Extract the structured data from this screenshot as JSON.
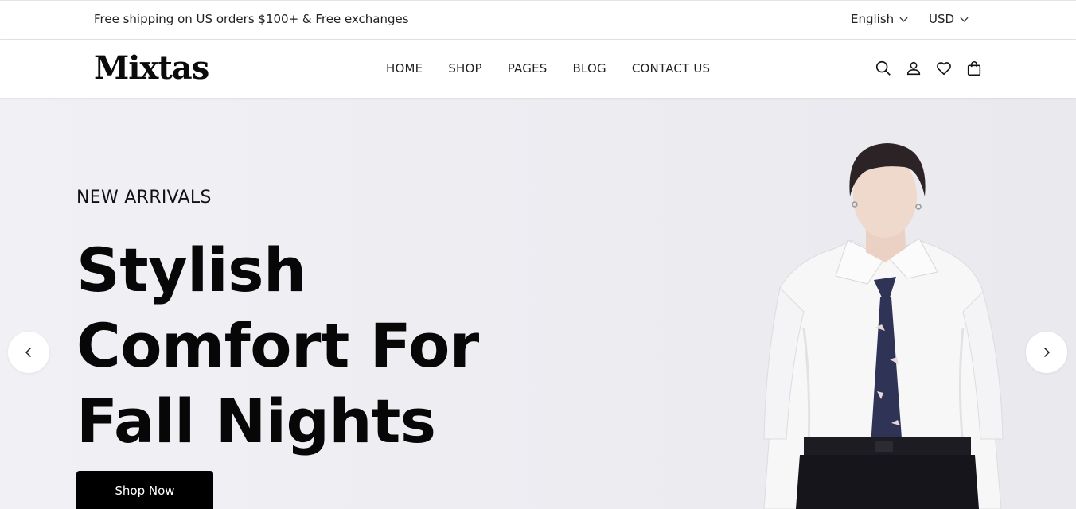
{
  "topbar": {
    "promo": "Free shipping on US orders $100+ & Free exchanges",
    "language": "English",
    "currency": "USD"
  },
  "header": {
    "logo": "Mixtas",
    "nav": [
      "HOME",
      "SHOP",
      "PAGES",
      "BLOG",
      "CONTACT US"
    ],
    "icons": [
      "search-icon",
      "user-icon",
      "heart-icon",
      "bag-icon"
    ]
  },
  "hero": {
    "kicker": "NEW ARRIVALS",
    "headline": [
      "Stylish",
      "Comfort For",
      "Fall Nights"
    ],
    "cta": "Shop Now",
    "image": "model in white shirt and patterned tie"
  },
  "colors": {
    "hero_bg": "#eeeef2",
    "cta_bg": "#000000",
    "text": "#111111"
  }
}
